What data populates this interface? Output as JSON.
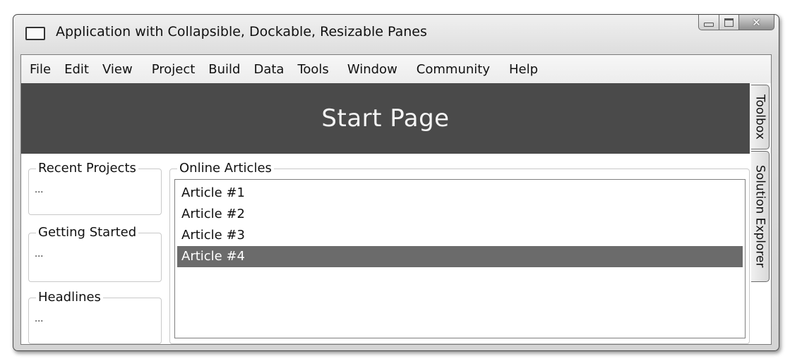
{
  "window": {
    "title": "Application with Collapsible, Dockable, Resizable Panes",
    "icon": "window-icon",
    "close_glyph": "✕"
  },
  "menu": {
    "items": [
      "File",
      "Edit",
      "View",
      "Project",
      "Build",
      "Data",
      "Tools",
      "Window",
      "Community",
      "Help"
    ]
  },
  "start_page": {
    "title": "Start Page"
  },
  "panes": {
    "recent_projects": {
      "label": "Recent Projects",
      "content": "..."
    },
    "getting_started": {
      "label": "Getting Started",
      "content": "..."
    },
    "headlines": {
      "label": "Headlines",
      "content": "..."
    },
    "online_articles": {
      "label": "Online Articles",
      "items": [
        "Article #1",
        "Article #2",
        "Article #3",
        "Article #4"
      ],
      "selected_index": 3
    }
  },
  "dock_tabs": {
    "toolbox": "Toolbox",
    "solution_explorer": "Solution Explorer"
  },
  "colors": {
    "banner": "#4a4a4a",
    "selection": "#6b6b6b"
  }
}
